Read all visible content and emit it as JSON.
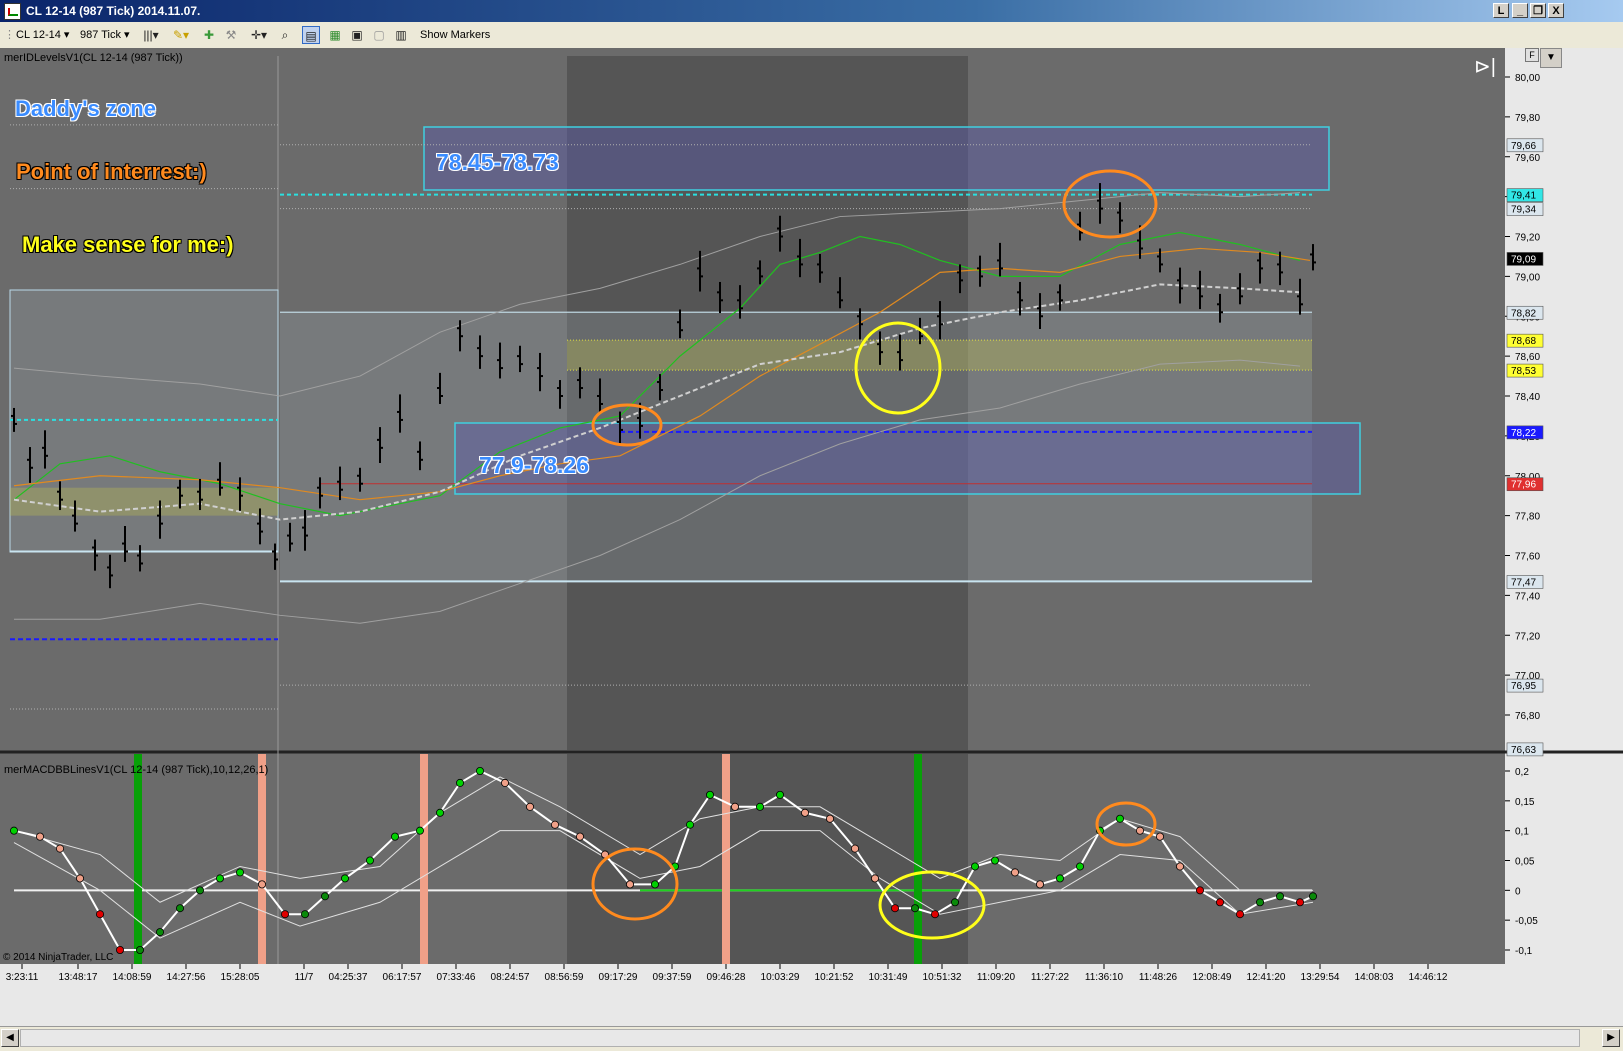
{
  "window": {
    "title": "CL 12-14 (987 Tick)  2014.11.07.",
    "buttons": [
      "L",
      "_",
      "❐",
      "X"
    ]
  },
  "toolbar": {
    "instrument": "CL 12-14",
    "interval": "987 Tick",
    "show_markers": "Show Markers"
  },
  "price_panel": {
    "indicator_label": "merIDLevelsV1(CL 12-14 (987 Tick))",
    "annotations": {
      "daddys_zone": "Daddy's zone",
      "point_of_interest": "Point of interrest:)",
      "make_sense": "Make sense for me:)",
      "upper_zone": "78.45-78.73",
      "lower_zone": "77.9-78.26"
    },
    "axis_ticks": [
      "80,00",
      "79,80",
      "79,60",
      "79,40",
      "79,20",
      "79,00",
      "78,80",
      "78,60",
      "78,40",
      "78,20",
      "78,00",
      "77,80",
      "77,60",
      "77,40",
      "77,20",
      "77,00",
      "76,80"
    ],
    "axis_ticks_values": [
      80.0,
      79.8,
      79.6,
      79.4,
      79.2,
      79.0,
      78.8,
      78.6,
      78.4,
      78.2,
      78.0,
      77.8,
      77.6,
      77.4,
      77.2,
      77.0,
      76.8
    ],
    "price_flags": [
      {
        "text": "79,66",
        "value": 79.66,
        "bg": "#dbe6ee",
        "fg": "#000000"
      },
      {
        "text": "79,41",
        "value": 79.41,
        "bg": "#32e6e6",
        "fg": "#000000"
      },
      {
        "text": "79,34",
        "value": 79.34,
        "bg": "#dbe6ee",
        "fg": "#000000"
      },
      {
        "text": "79,09",
        "value": 79.09,
        "bg": "#000000",
        "fg": "#ffffff"
      },
      {
        "text": "78,82",
        "value": 78.82,
        "bg": "#dbe6ee",
        "fg": "#000000"
      },
      {
        "text": "78,68",
        "value": 78.68,
        "bg": "#ffff33",
        "fg": "#000000"
      },
      {
        "text": "78,53",
        "value": 78.53,
        "bg": "#ffff33",
        "fg": "#000000"
      },
      {
        "text": "78,22",
        "value": 78.22,
        "bg": "#1a1aff",
        "fg": "#ffffff"
      },
      {
        "text": "77,96",
        "value": 77.96,
        "bg": "#e03030",
        "fg": "#ffffff"
      },
      {
        "text": "77,47",
        "value": 77.47,
        "bg": "#dbe6ee",
        "fg": "#000000"
      },
      {
        "text": "76,95",
        "value": 76.95,
        "bg": "#dbe6ee",
        "fg": "#000000"
      },
      {
        "text": "76,63",
        "value": 76.63,
        "bg": "#dbe6ee",
        "fg": "#000000"
      }
    ]
  },
  "macd_panel": {
    "indicator_label": "merMACDBBLinesV1(CL 12-14 (987 Tick),10,12,26,1)",
    "axis_ticks": [
      "0,2",
      "0,15",
      "0,1",
      "0,05",
      "0",
      "-0,05",
      "-0,1"
    ],
    "axis_ticks_values": [
      0.2,
      0.15,
      0.1,
      0.05,
      0,
      -0.05,
      -0.1
    ]
  },
  "time_axis": [
    "3:23:11",
    "13:48:17",
    "14:08:59",
    "14:27:56",
    "15:28:05",
    "11/7",
    "04:25:37",
    "06:17:57",
    "07:33:46",
    "08:24:57",
    "08:56:59",
    "09:17:29",
    "09:37:59",
    "09:46:28",
    "10:03:29",
    "10:21:52",
    "10:31:49",
    "10:51:32",
    "11:09:20",
    "11:27:22",
    "11:36:10",
    "11:48:26",
    "12:08:49",
    "12:41:20",
    "13:29:54",
    "14:08:03",
    "14:46:12"
  ],
  "copyright": "© 2014 NinjaTrader, LLC",
  "colors": {
    "chart_bg": "#6b6b6b",
    "session_shade": "#555555",
    "zone_border": "#3fd0e0",
    "annotation_blue": "#3a8cff",
    "annotation_orange": "#ff8a1e",
    "annotation_yellow": "#ffff1a",
    "macd_green": "#00d000",
    "macd_red": "#e00000",
    "macd_salmon": "#f0a088"
  }
}
